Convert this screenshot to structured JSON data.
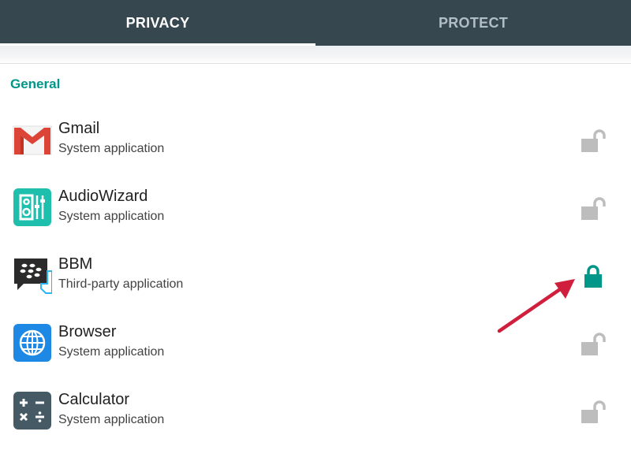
{
  "tabs": [
    {
      "label": "PRIVACY",
      "active": true
    },
    {
      "label": "PROTECT",
      "active": false
    }
  ],
  "section": {
    "title": "General"
  },
  "apps": [
    {
      "name": "Gmail",
      "type": "System application",
      "icon": "gmail-icon",
      "locked": false
    },
    {
      "name": "AudioWizard",
      "type": "System application",
      "icon": "audiowizard-icon",
      "locked": false
    },
    {
      "name": "BBM",
      "type": "Third-party application",
      "icon": "bbm-icon",
      "locked": true
    },
    {
      "name": "Browser",
      "type": "System application",
      "icon": "browser-icon",
      "locked": false
    },
    {
      "name": "Calculator",
      "type": "System application",
      "icon": "calculator-icon",
      "locked": false
    }
  ],
  "colors": {
    "tabbar": "#37474f",
    "accent": "#009688",
    "locked": "#009688",
    "unlocked": "#bdbdbd",
    "annotation_arrow": "#d01f3c"
  }
}
